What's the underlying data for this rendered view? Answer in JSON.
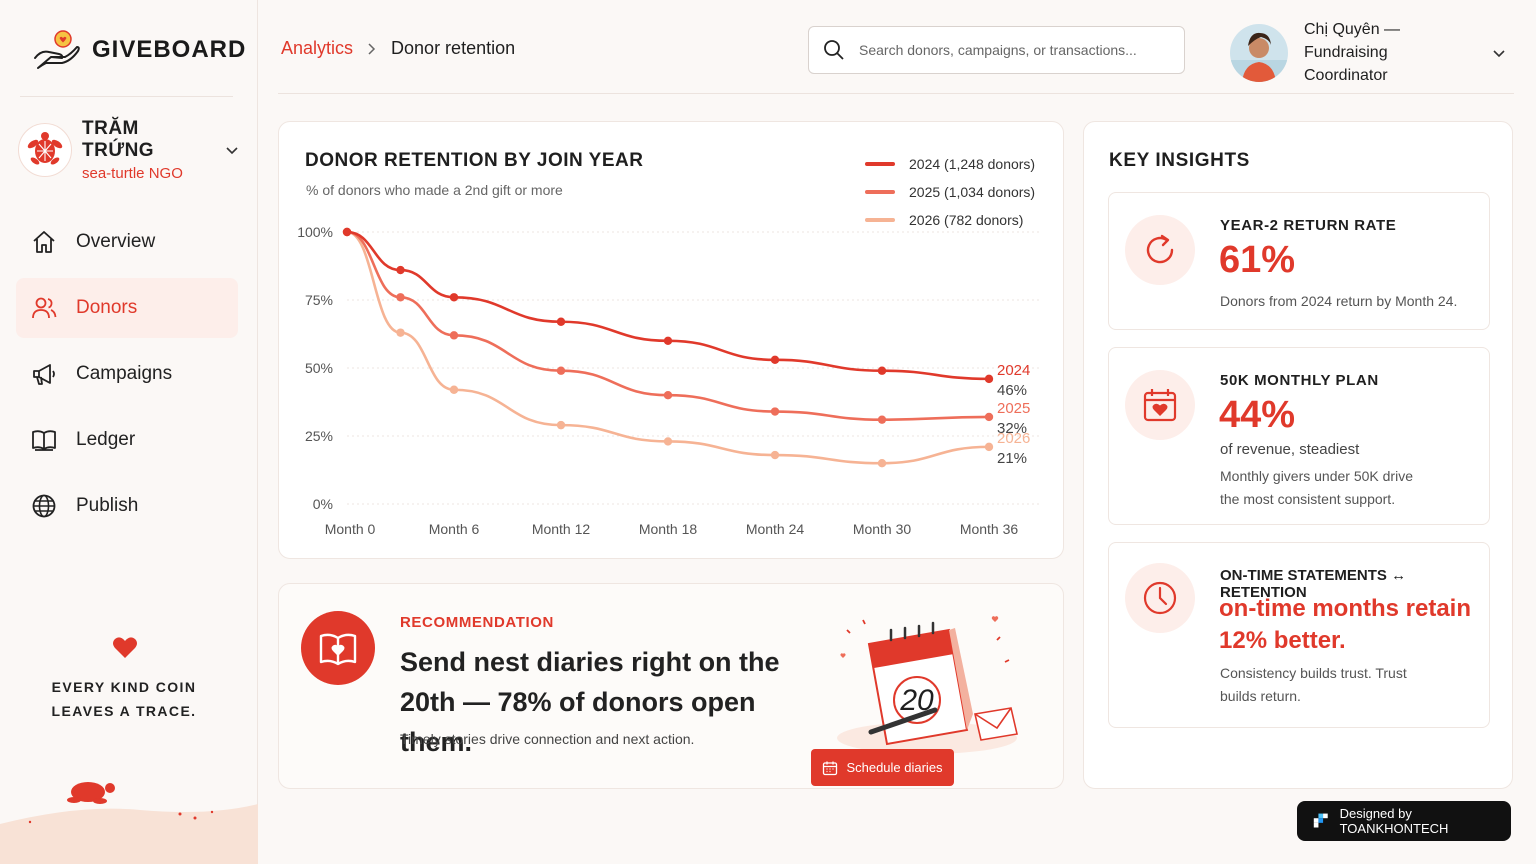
{
  "brand": {
    "name": "GIVEBOARD"
  },
  "org": {
    "name": "TRĂM TRỨNG",
    "subtitle": "sea-turtle NGO"
  },
  "nav": {
    "items": [
      {
        "label": "Overview",
        "icon": "home-icon"
      },
      {
        "label": "Donors",
        "icon": "users-icon",
        "active": true
      },
      {
        "label": "Campaigns",
        "icon": "megaphone-icon"
      },
      {
        "label": "Ledger",
        "icon": "book-icon"
      },
      {
        "label": "Publish",
        "icon": "globe-icon"
      }
    ]
  },
  "tagline": {
    "line1": "EVERY KIND COIN",
    "line2": "LEAVES A TRACE."
  },
  "breadcrumb": {
    "section": "Analytics",
    "page": "Donor retention"
  },
  "search": {
    "placeholder": "Search donors, campaigns, or transactions..."
  },
  "user": {
    "name_line1": "Chị Quyên — Fundraising",
    "name_line2": "Coordinator"
  },
  "chart_card": {
    "title": "DONOR RETENTION BY JOIN YEAR",
    "subtitle": "% of donors who made a 2nd gift or more",
    "legend": [
      {
        "label": "2024  (1,248 donors)",
        "color": "#e0392b"
      },
      {
        "label": "2025  (1,034 donors)",
        "color": "#ee6e5a"
      },
      {
        "label": "2026  (782 donors)",
        "color": "#f6b394"
      }
    ]
  },
  "chart_data": {
    "type": "line",
    "title": "DONOR RETENTION BY JOIN YEAR",
    "subtitle": "% of donors who made a 2nd gift or more",
    "x": [
      0,
      3,
      6,
      12,
      18,
      24,
      30,
      36
    ],
    "x_ticks": [
      0,
      6,
      12,
      18,
      24,
      30,
      36
    ],
    "x_tick_labels": [
      "Month 0",
      "Month 6",
      "Month 12",
      "Month 18",
      "Month 24",
      "Month 30",
      "Month 36"
    ],
    "y_ticks": [
      0,
      25,
      50,
      75,
      100
    ],
    "y_tick_labels": [
      "0%",
      "25%",
      "50%",
      "75%",
      "100%"
    ],
    "xlim": [
      0,
      36
    ],
    "ylim": [
      0,
      100
    ],
    "grid": true,
    "series": [
      {
        "name": "2024",
        "color": "#e0392b",
        "values": [
          100,
          86,
          76,
          67,
          60,
          53,
          49,
          46
        ],
        "end_label": "2024",
        "end_value": "46%"
      },
      {
        "name": "2025",
        "color": "#ee6e5a",
        "values": [
          100,
          76,
          62,
          49,
          40,
          34,
          31,
          32
        ],
        "end_label": "2025",
        "end_value": "32%"
      },
      {
        "name": "2026",
        "color": "#f6b394",
        "values": [
          100,
          63,
          42,
          29,
          23,
          18,
          15,
          21
        ],
        "end_label": "2026",
        "end_value": "21%"
      }
    ]
  },
  "recommendation": {
    "label": "RECOMMENDATION",
    "headline": "Send nest diaries right on the 20th — 78% of donors open them.",
    "body": "Timely stories drive connection and next action.",
    "calendar_day": "20",
    "button_label": "Schedule diaries"
  },
  "insights": {
    "title": "KEY INSIGHTS",
    "cards": [
      {
        "label": "YEAR-2  RETURN RATE",
        "value": "61%",
        "desc": "Donors from 2024 return by Month 24."
      },
      {
        "label": "50K MONTHLY PLAN",
        "value": "44%",
        "desc_lead": "of revenue, steadiest",
        "desc1": "Monthly givers under 50K drive",
        "desc2": "the most consistent support."
      },
      {
        "label": "ON-TIME STATEMENTS ↔ RETENTION",
        "value1": "on-time months retain",
        "value2": "12% better.",
        "desc1": "Consistency builds trust. Trust",
        "desc2": "builds return."
      }
    ]
  },
  "badge": {
    "text": "Designed by TOANKHONTECH"
  }
}
